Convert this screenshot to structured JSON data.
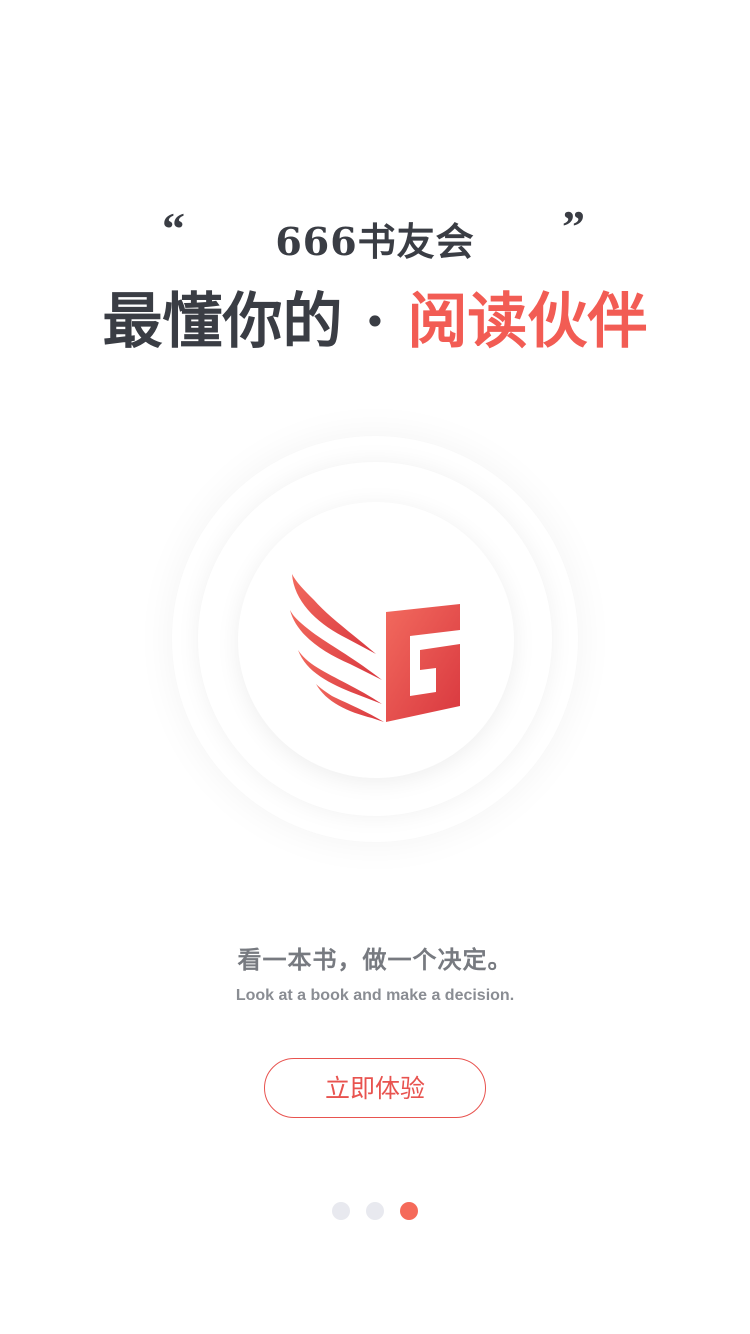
{
  "header": {
    "quote_open": "“",
    "quote_close": "”",
    "brand_title": "666书友会",
    "slogan_dark": "最懂你的",
    "slogan_separator": "·",
    "slogan_accent": "阅读伙伴"
  },
  "logo": {
    "icon": "book-wing-g-logo",
    "colors": [
      "#f26a5e",
      "#d9383f"
    ]
  },
  "tagline": {
    "cn": "看一本书，做一个决定。",
    "en": "Look at a book and make a decision."
  },
  "cta": {
    "label": "立即体验"
  },
  "pager": {
    "total": 3,
    "active_index": 2
  },
  "colors": {
    "accent": "#f25c54",
    "text_dark": "#3a3d44",
    "pager_inactive": "#e8e9ef",
    "pager_active": "#f56a5a"
  }
}
